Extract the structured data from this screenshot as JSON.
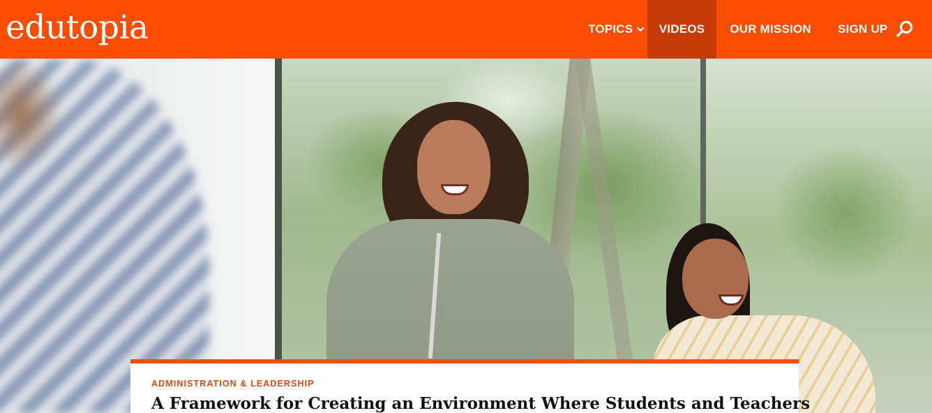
{
  "header": {
    "logo_text": "edutopia",
    "brand_color": "#fa4d00",
    "nav": {
      "topics_label": "TOPICS",
      "videos_label": "VIDEOS",
      "mission_label": "OUR MISSION",
      "signup_label": "SIGN UP",
      "active_item": "VIDEOS",
      "search_icon": "search-icon",
      "topics_icon": "chevron-down-icon"
    }
  },
  "hero": {
    "image_alt_theme": "two smiling women in a bright room"
  },
  "article": {
    "category": "ADMINISTRATION & LEADERSHIP",
    "title": "A Framework for Creating an Environment Where Students and Teachers",
    "accent_color": "#fa4d00"
  }
}
